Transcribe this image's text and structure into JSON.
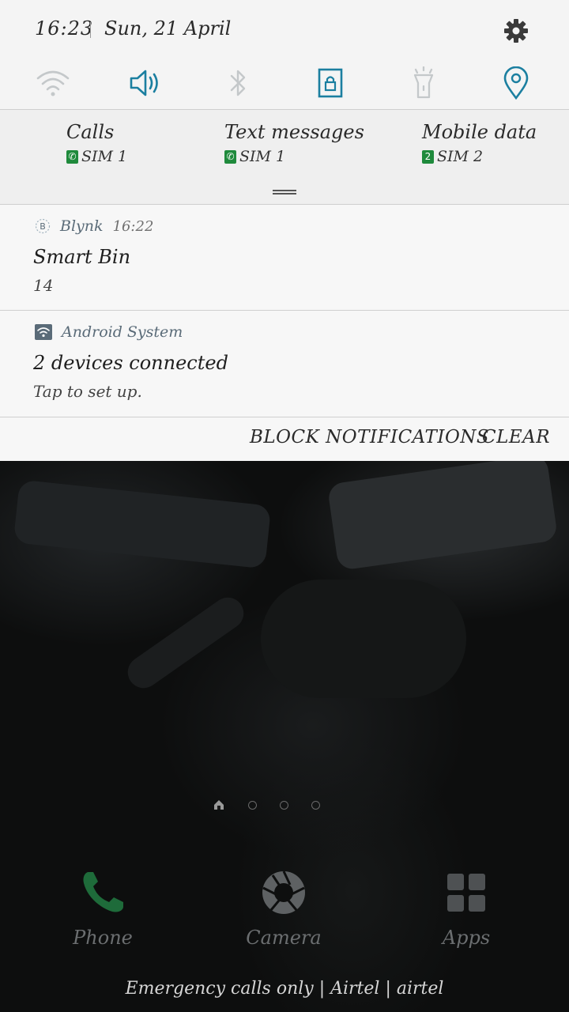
{
  "status": {
    "time": "16:23",
    "date": "Sun, 21 April",
    "settings_icon": "gear-icon"
  },
  "quick_settings": [
    {
      "name": "wifi",
      "icon": "wifi-icon",
      "active": false
    },
    {
      "name": "sound",
      "icon": "speaker-icon",
      "active": true
    },
    {
      "name": "bluetooth",
      "icon": "bluetooth-icon",
      "active": false
    },
    {
      "name": "screen-lock",
      "icon": "lock-icon",
      "active": true
    },
    {
      "name": "torch",
      "icon": "flashlight-icon",
      "active": false
    },
    {
      "name": "location",
      "icon": "location-pin-icon",
      "active": true
    }
  ],
  "sim_settings": {
    "calls": {
      "label": "Calls",
      "sim_num": "1",
      "sim": "SIM 1"
    },
    "texts": {
      "label": "Text messages",
      "sim_num": "1",
      "sim": "SIM 1"
    },
    "data": {
      "label": "Mobile data",
      "sim_num": "2",
      "sim": "SIM 2"
    }
  },
  "notifications": [
    {
      "app": "Blynk",
      "time": "16:22",
      "title": "Smart Bin",
      "body": "14"
    },
    {
      "app": "Android System",
      "time": "",
      "title": "2 devices connected",
      "body": "Tap to set up."
    }
  ],
  "actions": {
    "block": "BLOCK NOTIFICATIONS",
    "clear": "CLEAR"
  },
  "dock": [
    {
      "label": "Phone",
      "icon": "phone-icon"
    },
    {
      "label": "Camera",
      "icon": "camera-shutter-icon"
    },
    {
      "label": "Apps",
      "icon": "apps-grid-icon"
    }
  ],
  "carrier_text": "Emergency calls only | Airtel | airtel",
  "colors": {
    "accent": "#1b7fa0",
    "sim_badge": "#1f8a3c",
    "shade_bg": "#f4f4f4"
  }
}
